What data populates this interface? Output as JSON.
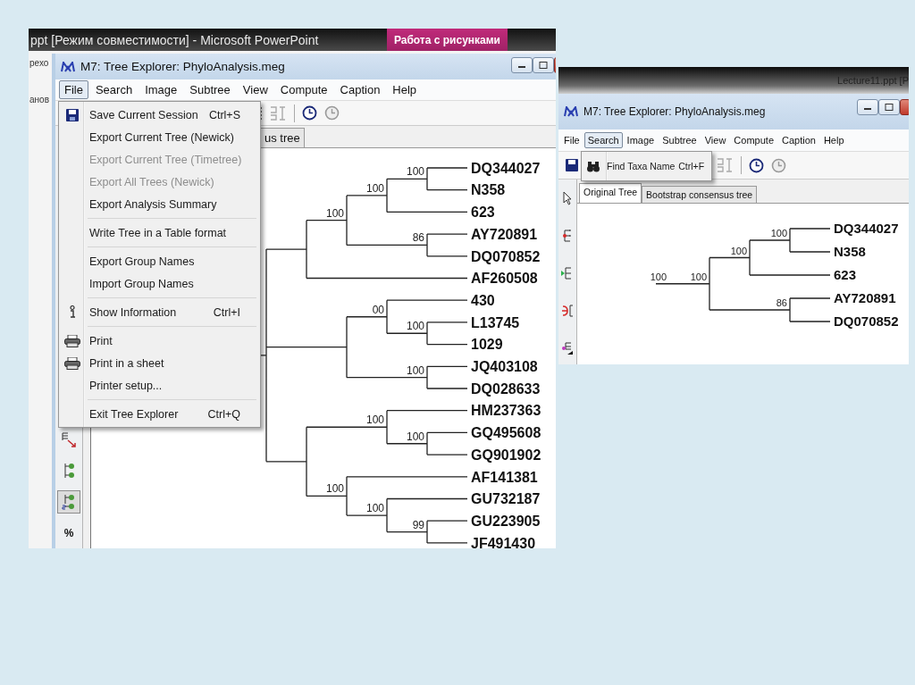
{
  "screenshot_1": {
    "powerpoint_bar": {
      "title": "ppt [Режим совместимости] - Microsoft PowerPoint",
      "context_tab": "Работа с рисунками"
    },
    "ribbon_fragments": [
      "рехо",
      "анов"
    ],
    "window": {
      "title": "M7: Tree Explorer: PhyloAnalysis.meg",
      "menu": [
        {
          "label": "File",
          "selected": true
        },
        {
          "label": "Search",
          "selected": false
        },
        {
          "label": "Image",
          "selected": false
        },
        {
          "label": "Subtree",
          "selected": false
        },
        {
          "label": "View",
          "selected": false
        },
        {
          "label": "Compute",
          "selected": false
        },
        {
          "label": "Caption",
          "selected": false
        },
        {
          "label": "Help",
          "selected": false
        }
      ],
      "open_menu": [
        {
          "kind": "floppy",
          "label": "Save Current Session",
          "shortcut": "Ctrl+S",
          "disabled": false
        },
        {
          "kind": "plain",
          "label": "Export Current Tree (Newick)",
          "disabled": false
        },
        {
          "kind": "plain",
          "label": "Export Current Tree (Timetree)",
          "disabled": true
        },
        {
          "kind": "plain",
          "label": "Export All Trees (Newick)",
          "disabled": true
        },
        {
          "kind": "plain",
          "label": "Export Analysis Summary",
          "disabled": false
        },
        {
          "kind": "separator"
        },
        {
          "kind": "plain",
          "label": "Write Tree in a Table format",
          "disabled": false
        },
        {
          "kind": "separator"
        },
        {
          "kind": "plain",
          "label": "Export Group Names",
          "disabled": false
        },
        {
          "kind": "plain",
          "label": "Import Group Names",
          "disabled": false
        },
        {
          "kind": "separator"
        },
        {
          "kind": "info",
          "label": "Show Information",
          "shortcut": "Ctrl+I",
          "disabled": false
        },
        {
          "kind": "separator"
        },
        {
          "kind": "printer",
          "label": "Print",
          "disabled": false
        },
        {
          "kind": "printer",
          "label": "Print in a sheet",
          "disabled": false
        },
        {
          "kind": "plain",
          "label": "Printer setup...",
          "disabled": false
        },
        {
          "kind": "separator"
        },
        {
          "kind": "plain",
          "label": "Exit Tree Explorer",
          "shortcut": "Ctrl+Q",
          "disabled": false
        }
      ],
      "tabs": [
        {
          "label": "us tree",
          "selected": false
        }
      ],
      "side_tools": [
        {
          "kind": "swap",
          "pressed": false
        },
        {
          "kind": "node",
          "pressed": false
        },
        {
          "kind": "node-s",
          "pressed": true
        },
        {
          "kind": "percent",
          "label": "%",
          "pressed": false
        }
      ],
      "tree": {
        "children": [
          {
            "children": [
              {
                "support": "100",
                "children": [
                  {
                    "support": "100",
                    "children": [
                      {
                        "support": "100",
                        "children": [
                          {
                            "taxon": "DQ344027"
                          },
                          {
                            "taxon": "N358"
                          }
                        ]
                      },
                      {
                        "taxon": "623"
                      }
                    ]
                  },
                  {
                    "support": "86",
                    "children": [
                      {
                        "taxon": "AY720891"
                      },
                      {
                        "taxon": "DQ070852"
                      }
                    ]
                  }
                ]
              },
              {
                "taxon": "AF260508"
              }
            ]
          },
          {
            "children": [
              {
                "support": "00",
                "children": [
                  {
                    "taxon": "430"
                  },
                  {
                    "support": "100",
                    "children": [
                      {
                        "taxon": "L13745"
                      },
                      {
                        "taxon": "1029"
                      }
                    ]
                  }
                ]
              },
              {
                "support": "100",
                "children": [
                  {
                    "taxon": "JQ403108"
                  },
                  {
                    "taxon": "DQ028633"
                  }
                ]
              }
            ]
          },
          {
            "children": [
              {
                "support": "100",
                "children": [
                  {
                    "taxon": "HM237363"
                  },
                  {
                    "support": "100",
                    "children": [
                      {
                        "taxon": "GQ495608"
                      },
                      {
                        "taxon": "GQ901902"
                      }
                    ]
                  }
                ]
              },
              {
                "support": "100",
                "children": [
                  {
                    "taxon": "AF141381"
                  },
                  {
                    "support": "100",
                    "children": [
                      {
                        "taxon": "GU732187"
                      },
                      {
                        "support": "99",
                        "children": [
                          {
                            "taxon": "GU223905"
                          },
                          {
                            "taxon": "JF491430"
                          }
                        ]
                      }
                    ]
                  }
                ]
              }
            ]
          }
        ]
      }
    }
  },
  "screenshot_2": {
    "powerpoint_bar": {
      "title": "Lecture11.ppt [P"
    },
    "window": {
      "title": "M7: Tree Explorer: PhyloAnalysis.meg",
      "menu": [
        {
          "label": "File",
          "selected": false
        },
        {
          "label": "Search",
          "selected": true
        },
        {
          "label": "Image",
          "selected": false
        },
        {
          "label": "Subtree",
          "selected": false
        },
        {
          "label": "View",
          "selected": false
        },
        {
          "label": "Compute",
          "selected": false
        },
        {
          "label": "Caption",
          "selected": false
        },
        {
          "label": "Help",
          "selected": false
        }
      ],
      "open_menu": [
        {
          "kind": "binoculars",
          "label": "Find Taxa Name",
          "shortcut": "Ctrl+F",
          "disabled": false
        }
      ],
      "tabs": [
        {
          "label": "Original Tree",
          "selected": true
        },
        {
          "label": "Bootstrap consensus tree",
          "selected": false
        }
      ],
      "side_tools": [
        {
          "kind": "pointer"
        },
        {
          "kind": "tree-red"
        },
        {
          "kind": "tree-green"
        },
        {
          "kind": "split"
        },
        {
          "kind": "tree-magenta"
        }
      ],
      "tree": {
        "support": "100",
        "children": [
          {
            "support": "100",
            "children": [
              {
                "support": "100",
                "children": [
                  {
                    "support": "100",
                    "children": [
                      {
                        "taxon": "DQ344027"
                      },
                      {
                        "taxon": "N358"
                      }
                    ]
                  },
                  {
                    "taxon": "623"
                  }
                ]
              },
              {
                "support": "86",
                "children": [
                  {
                    "taxon": "AY720891"
                  },
                  {
                    "taxon": "DQ070852"
                  }
                ]
              }
            ]
          }
        ]
      }
    }
  }
}
